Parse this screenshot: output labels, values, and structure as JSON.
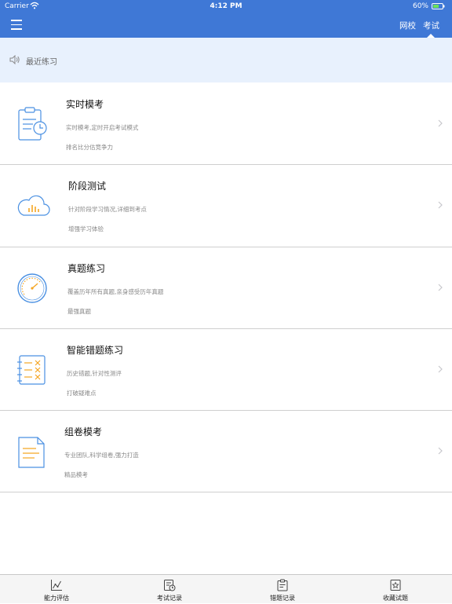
{
  "status": {
    "carrier": "Carrier",
    "time": "4:12 PM",
    "battery": "60%"
  },
  "nav": {
    "tabs": [
      {
        "label": "网校"
      },
      {
        "label": "考试"
      }
    ],
    "active_tab": "考试",
    "color": "#3f78d6"
  },
  "notice": {
    "text": "最近练习"
  },
  "items": [
    {
      "title": "实时模考",
      "line1": "实时模考,定时开启考试模式",
      "line2": "排名比分估竞争力",
      "icon": "clipboard-clock-icon"
    },
    {
      "title": "阶段测试",
      "line1": "针对阶段学习情况,详细到考点",
      "line2": "增强学习体验",
      "icon": "cloud-chart-icon"
    },
    {
      "title": "真题练习",
      "line1": "覆盖历年所有真题,亲身感受历年真题",
      "line2": "最强真题",
      "icon": "gauge-icon"
    },
    {
      "title": "智能错题练习",
      "line1": "历史错题,针对性测评",
      "line2": "打破疑难点",
      "icon": "checklist-x-icon"
    },
    {
      "title": "组卷模考",
      "line1": "专业团队,科学组卷,强力打造",
      "line2": "精品模考",
      "icon": "document-icon"
    }
  ],
  "tabbar": [
    {
      "label": "能力评估",
      "icon": "chart-icon"
    },
    {
      "label": "考试记录",
      "icon": "exam-record-icon"
    },
    {
      "label": "错题记录",
      "icon": "mistake-record-icon"
    },
    {
      "label": "收藏试题",
      "icon": "favorites-icon"
    }
  ]
}
